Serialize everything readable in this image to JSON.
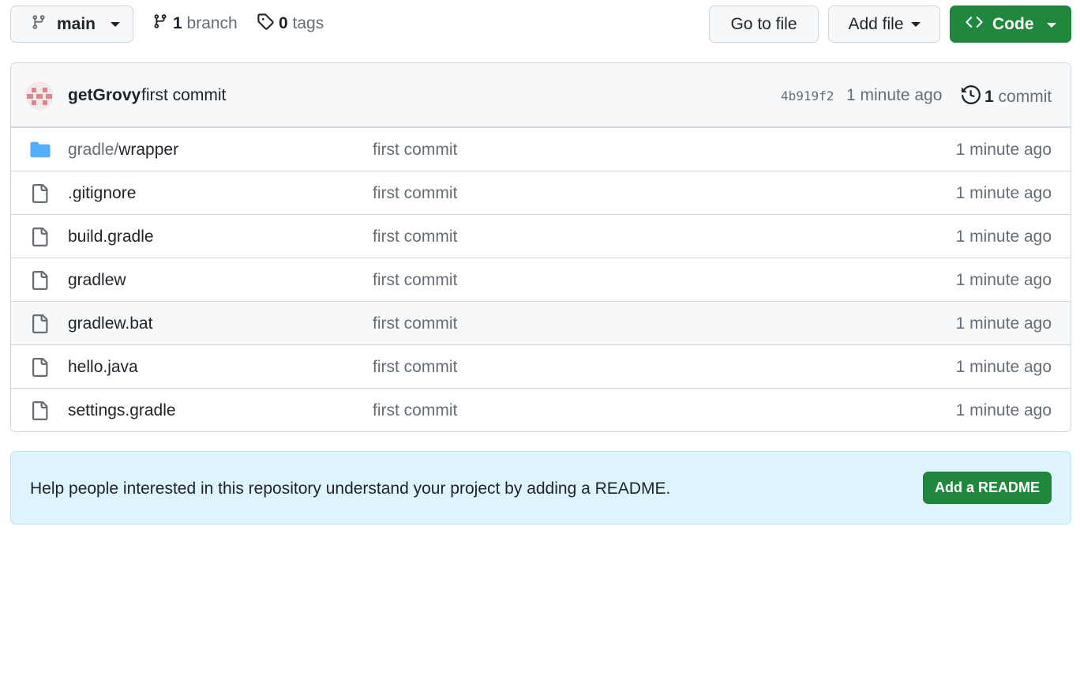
{
  "toolbar": {
    "branch_selector": "main",
    "branches_count": "1",
    "branches_label": "branch",
    "tags_count": "0",
    "tags_label": "tags",
    "go_to_file": "Go to file",
    "add_file": "Add file",
    "code": "Code"
  },
  "latest_commit": {
    "author": "getGrovy",
    "message": "first commit",
    "sha": "4b919f2",
    "time": "1 minute ago",
    "commits_count": "1",
    "commits_label": "commit"
  },
  "files": [
    {
      "type": "folder",
      "name_prefix": "gradle/",
      "name": "wrapper",
      "message": "first commit",
      "time": "1 minute ago"
    },
    {
      "type": "file",
      "name_prefix": "",
      "name": ".gitignore",
      "message": "first commit",
      "time": "1 minute ago"
    },
    {
      "type": "file",
      "name_prefix": "",
      "name": "build.gradle",
      "message": "first commit",
      "time": "1 minute ago"
    },
    {
      "type": "file",
      "name_prefix": "",
      "name": "gradlew",
      "message": "first commit",
      "time": "1 minute ago"
    },
    {
      "type": "file",
      "name_prefix": "",
      "name": "gradlew.bat",
      "message": "first commit",
      "time": "1 minute ago"
    },
    {
      "type": "file",
      "name_prefix": "",
      "name": "hello.java",
      "message": "first commit",
      "time": "1 minute ago"
    },
    {
      "type": "file",
      "name_prefix": "",
      "name": "settings.gradle",
      "message": "first commit",
      "time": "1 minute ago"
    }
  ],
  "readme_banner": {
    "text": "Help people interested in this repository understand your project by adding a README.",
    "button": "Add a README"
  },
  "colors": {
    "primary_green": "#1f883d",
    "folder_blue": "#54aeff",
    "banner_bg": "#ddf4ff"
  }
}
